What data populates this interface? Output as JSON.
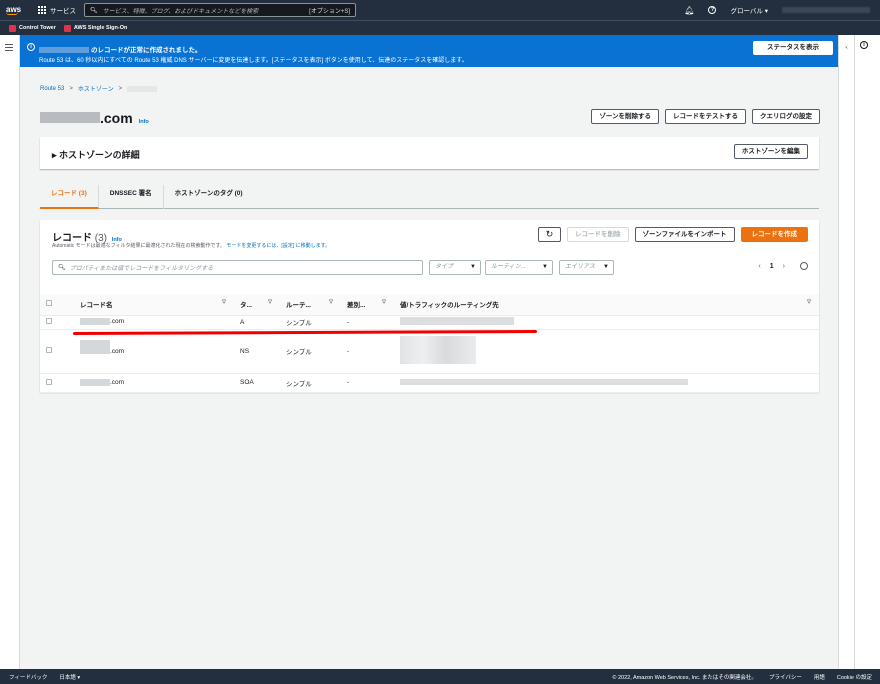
{
  "nav": {
    "logo": "aws",
    "services": "サービス",
    "search_placeholder": "サービス、特徴、ブログ、およびドキュメントなどを検索",
    "search_shortcut": "[オプション+S]",
    "region": "グローバル ▾"
  },
  "favorites": [
    "Control Tower",
    "AWS Single Sign-On"
  ],
  "flash": {
    "title": "のレコードが正常に作成されました。",
    "message": "Route 53 は、60 秒以内にすべての Route 53 権威 DNS サーバーに変更を伝達します。[ステータスを表示] ボタンを使用して、伝達のステータスを確認します。",
    "button": "ステータスを表示",
    "close": "✕",
    "color": "#0972d3"
  },
  "breadcrumb": {
    "root": "Route 53",
    "sep": ">",
    "zones": "ホストゾーン"
  },
  "page": {
    "title_suffix": ".com",
    "info": "Info",
    "actions": [
      "ゾーンを削除する",
      "レコードをテストする",
      "クエリログの設定"
    ]
  },
  "details": {
    "title": "▸ ホストゾーンの詳細",
    "edit": "ホストゾーンを編集"
  },
  "tabs": [
    "レコード (3)",
    "DNSSEC 署名",
    "ホストゾーンのタグ (0)"
  ],
  "records": {
    "title": "レコード",
    "count": "(3)",
    "info": "Info",
    "sub_text": "Automatic モードは最適なフィルタ結果に最適化された現在の検索動作です。",
    "sub_link": "モードを変更するには、[設定] に移動します。",
    "refresh": "↻",
    "delete": "レコードを削除",
    "import": "ゾーンファイルをインポート",
    "create": "レコードを作成",
    "filter_placeholder": "プロパティまたは値でレコードをフィルタリングする",
    "type_select": "タイプ",
    "routing_select": "ルーティン...",
    "alias_select": "エイリアス",
    "page": "1",
    "columns": [
      "レコード名",
      "タ...",
      "ルーテ...",
      "差別...",
      "値/トラフィックのルーティング先"
    ],
    "rows": [
      {
        "name": ".com",
        "type": "A",
        "routing": "シンプル",
        "diff": "-"
      },
      {
        "name": ".com",
        "type": "NS",
        "routing": "シンプル",
        "diff": "-"
      },
      {
        "name": ".com",
        "type": "SOA",
        "routing": "シンプル",
        "diff": "-"
      }
    ]
  },
  "footer": {
    "feedback": "フィードバック",
    "language": "日本語 ▾",
    "copyright": "© 2022, Amazon Web Services, Inc. またはその関連会社。",
    "privacy": "プライバシー",
    "terms": "用語",
    "cookie": "Cookie の設定"
  }
}
